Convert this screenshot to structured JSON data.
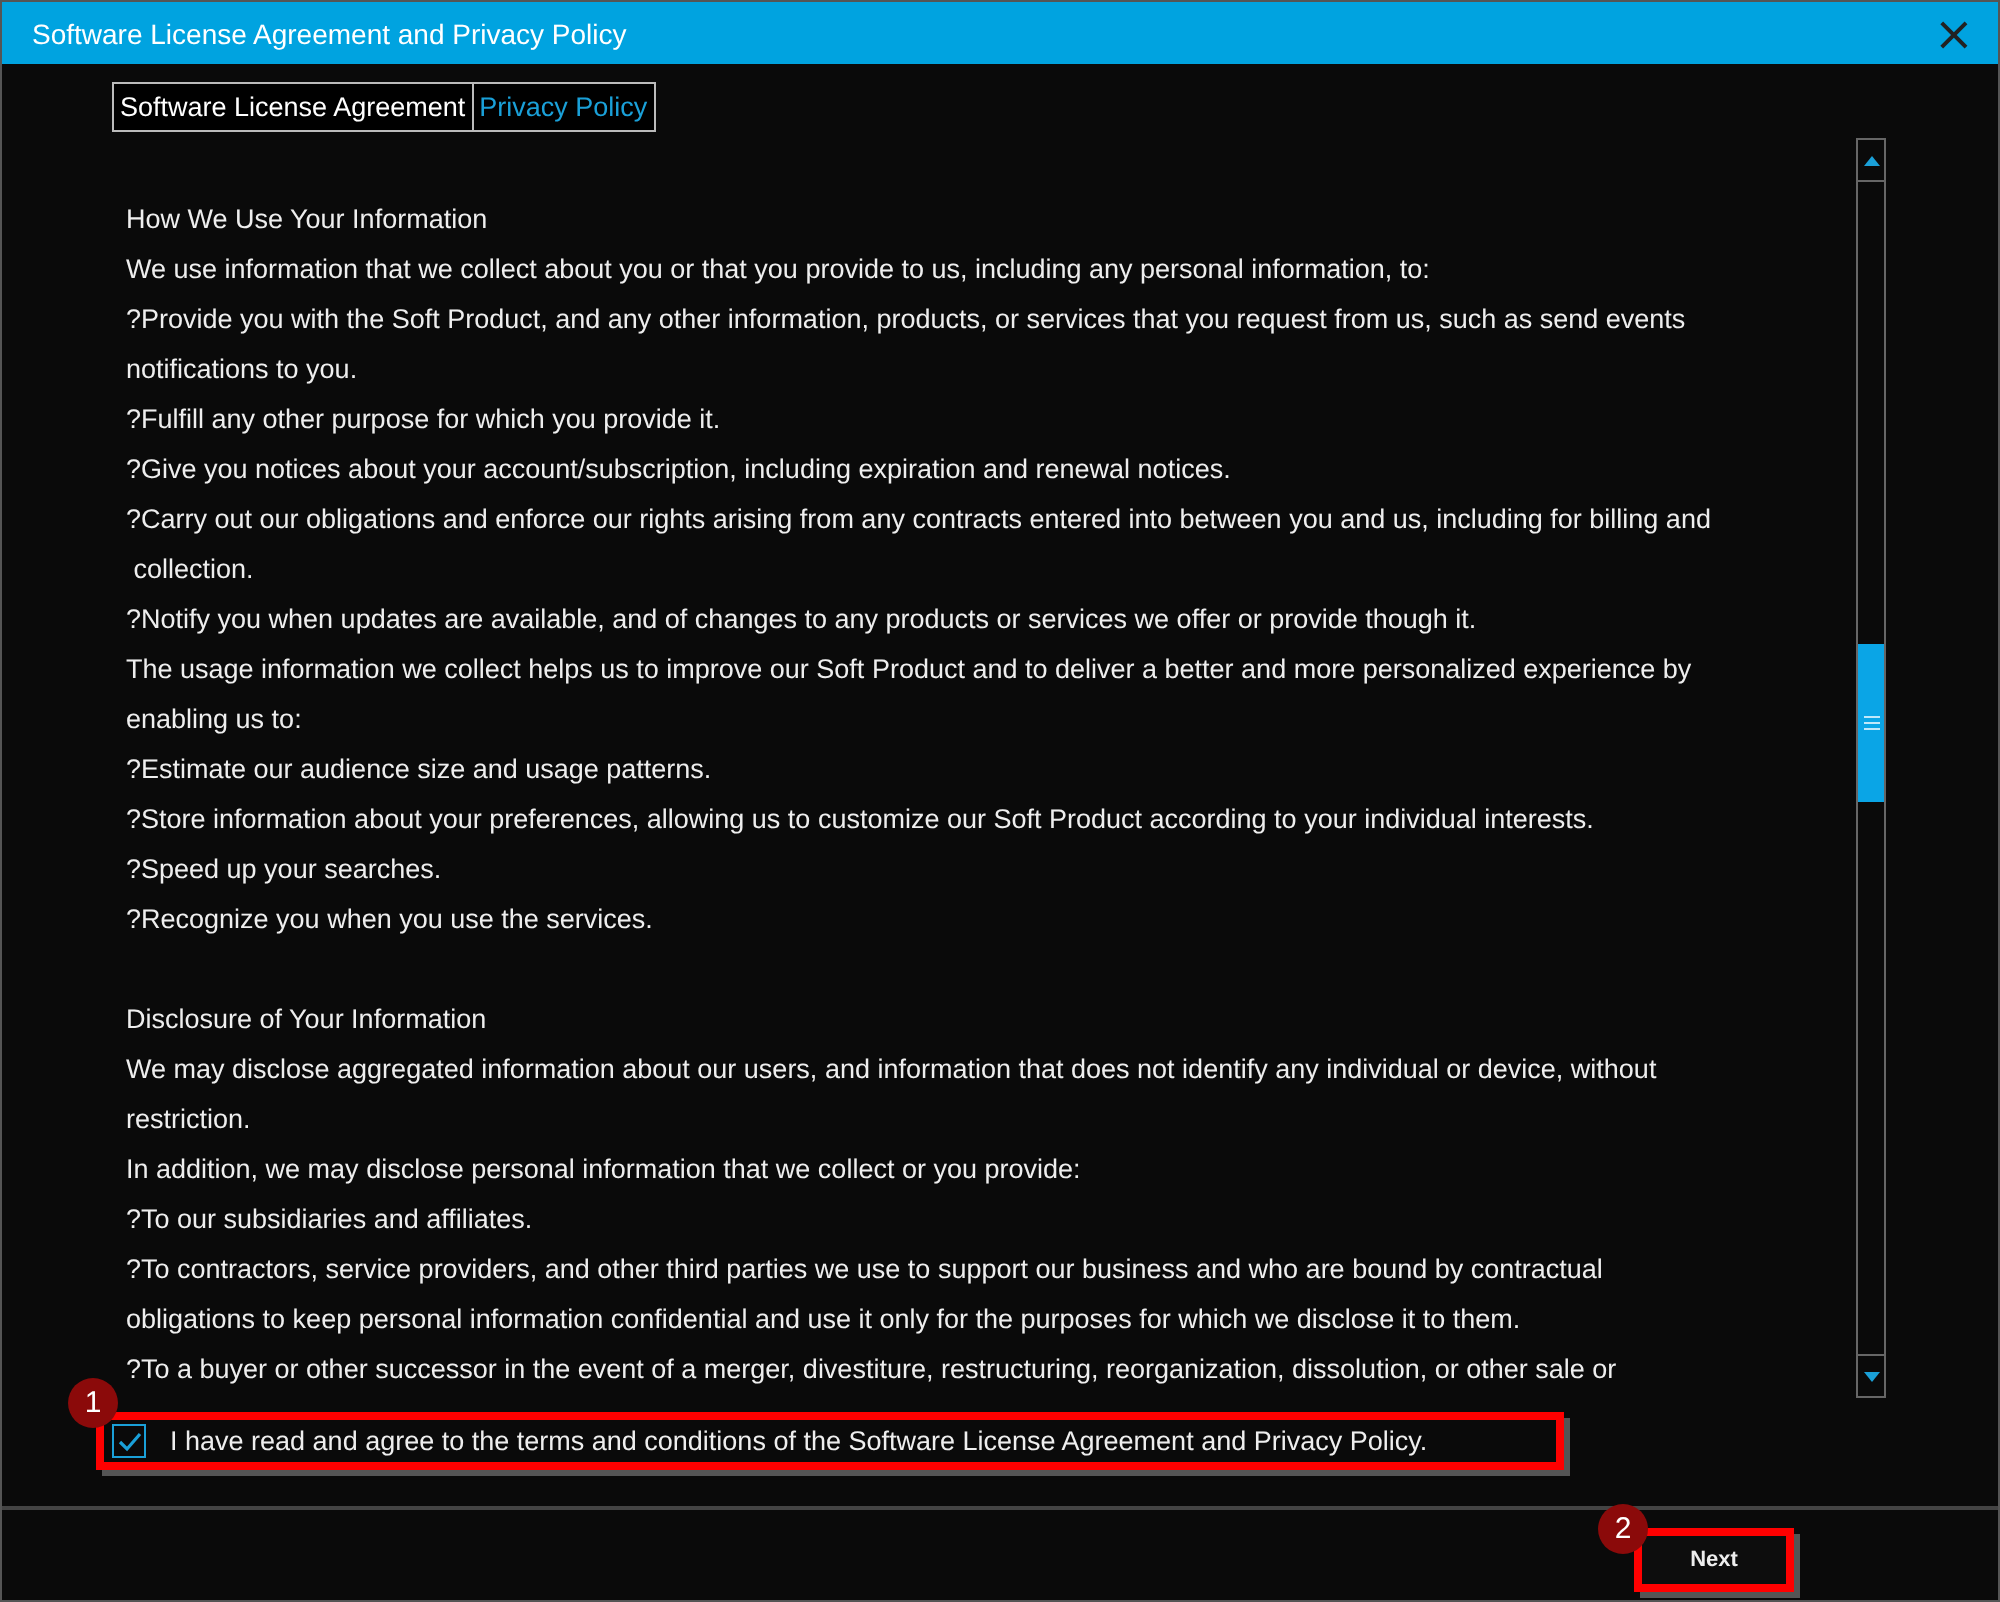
{
  "window": {
    "title": "Software License Agreement and Privacy Policy",
    "close": "×"
  },
  "tabs": [
    {
      "label": "Software License Agreement",
      "selected": false
    },
    {
      "label": "Privacy Policy",
      "selected": true
    }
  ],
  "document": {
    "sections": [
      {
        "heading": "How We Use Your Information",
        "lines": [
          "We use information that we collect about you or that you provide to us, including any personal information, to:",
          "?Provide you with the Soft Product, and any other information, products, or services that you request from us, such as send events",
          "notifications to you.",
          "?Fulfill any other purpose for which you provide it.",
          "?Give you notices about your account/subscription, including expiration and renewal notices.",
          "?Carry out our obligations and enforce our rights arising from any contracts entered into between you and us, including for billing and",
          " collection.",
          "?Notify you when updates are available, and of changes to any products or services we offer or provide though it.",
          "The usage information we collect helps us to improve our Soft Product and to deliver a better and more personalized experience by",
          "enabling us to:",
          "?Estimate our audience size and usage patterns.",
          "?Store information about your preferences, allowing us to customize our Soft Product according to your individual interests.",
          "?Speed up your searches.",
          "?Recognize you when you use the services."
        ]
      },
      {
        "heading": "Disclosure of Your Information",
        "lines": [
          "We may disclose aggregated information about our users, and information that does not identify any individual or device, without",
          "restriction.",
          "In addition, we may disclose personal information that we collect or you provide:",
          "?To our subsidiaries and affiliates.",
          "?To contractors, service providers, and other third parties we use to support our business and who are bound by contractual",
          "obligations to keep personal information confidential and use it only for the purposes for which we disclose it to them.",
          "?To a buyer or other successor in the event of a merger, divestiture, restructuring, reorganization, dissolution, or other sale or"
        ]
      }
    ]
  },
  "agree": {
    "label": "I have read and agree to the terms and conditions of the Software License Agreement and Privacy Policy.",
    "checked": true,
    "marker": "1"
  },
  "next_button": {
    "label": "Next",
    "marker": "2"
  }
}
